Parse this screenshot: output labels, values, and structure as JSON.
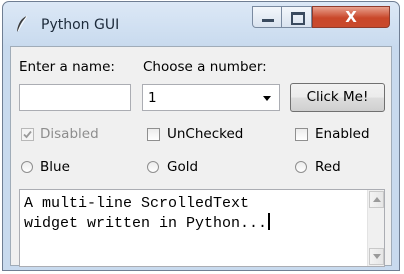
{
  "window": {
    "title": "Python GUI",
    "close_glyph": "X",
    "icon": "feather-icon"
  },
  "form": {
    "name_label": "Enter a name:",
    "name_value": "",
    "number_label": "Choose a number:",
    "number_selected": "1",
    "button_label": "Click Me!"
  },
  "checkboxes": [
    {
      "label": "Disabled",
      "checked": true,
      "disabled": true
    },
    {
      "label": "UnChecked",
      "checked": false,
      "disabled": false
    },
    {
      "label": "Enabled",
      "checked": false,
      "disabled": false
    }
  ],
  "radios": [
    {
      "label": "Blue",
      "selected": false
    },
    {
      "label": "Gold",
      "selected": false
    },
    {
      "label": "Red",
      "selected": false
    }
  ],
  "scrolled_text": {
    "content": "A multi-line ScrolledText\nwidget written in Python..."
  },
  "colors": {
    "titlebar": "#c8daee",
    "client_bg": "#f0f0f0",
    "close_button": "#c9472a"
  }
}
